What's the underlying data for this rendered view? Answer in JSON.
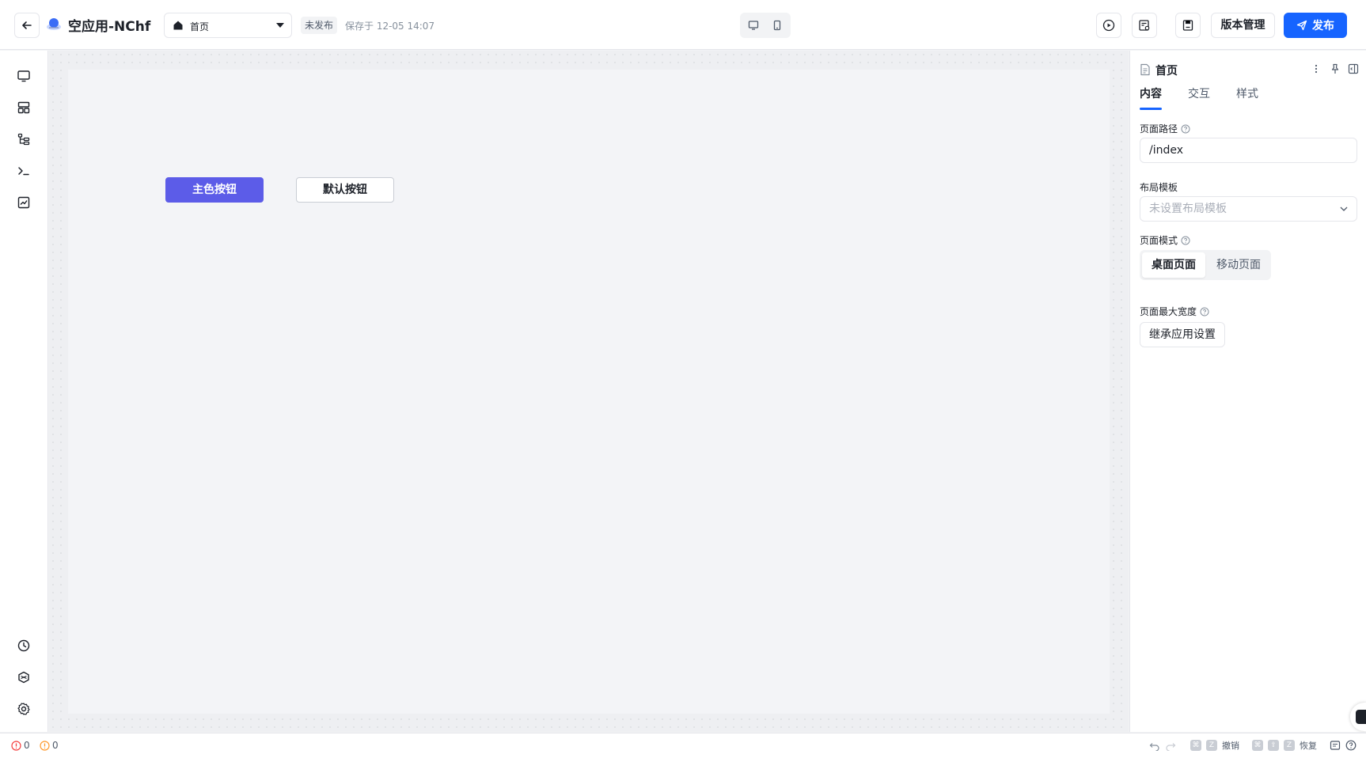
{
  "header": {
    "back_icon": "arrow-left-icon",
    "app_title": "空应用-NChf",
    "page_select": {
      "value": "首页",
      "icon": "home-icon"
    },
    "publish_status": "未发布",
    "save_time": "保存于 12-05 14:07",
    "device_modes": [
      "desktop-icon",
      "mobile-icon"
    ],
    "toolbar_icons": [
      "play-icon",
      "preview-icon",
      "save-icon"
    ],
    "version_label": "版本管理",
    "publish_label": "发布",
    "colors": {
      "primary": "#1664ff"
    }
  },
  "left_rail": {
    "top_icons": [
      "monitor-icon",
      "layout-icon",
      "tree-icon",
      "terminal-icon",
      "chart-icon"
    ],
    "bottom_icons": [
      "history-icon",
      "plugin-icon",
      "settings-icon"
    ]
  },
  "canvas": {
    "primary_button_label": "主色按钮",
    "default_button_label": "默认按钮",
    "colors": {
      "primary_button": "#5c5ce8"
    }
  },
  "right_panel": {
    "title": "首页",
    "tabs": [
      "内容",
      "交互",
      "样式"
    ],
    "active_tab": "内容",
    "page_path": {
      "label": "页面路径",
      "value": "/index"
    },
    "layout_template": {
      "label": "布局模板",
      "placeholder": "未设置布局模板"
    },
    "page_mode": {
      "label": "页面模式",
      "options": [
        "桌面页面",
        "移动页面"
      ],
      "selected": "桌面页面"
    },
    "max_width": {
      "label": "页面最大宽度",
      "button": "继承应用设置"
    }
  },
  "status_bar": {
    "errors": "0",
    "warnings": "0",
    "undo_label": "撤销",
    "redo_label": "恢复",
    "undo_keys": [
      "⌘",
      "Z"
    ],
    "redo_keys": [
      "⌘",
      "⇧",
      "Z"
    ]
  }
}
